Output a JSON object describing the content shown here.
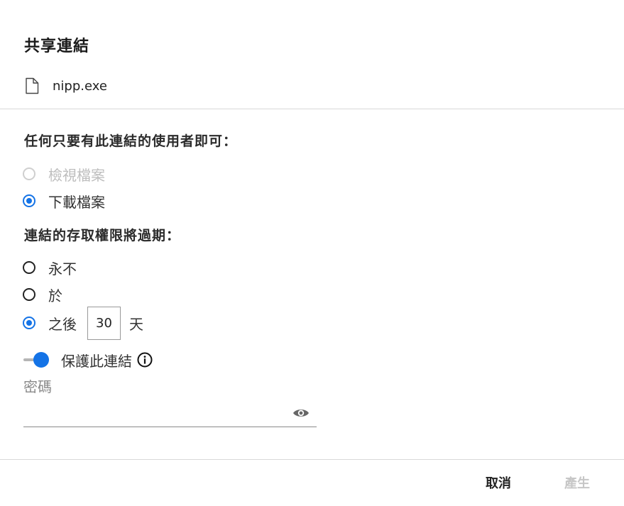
{
  "dialog": {
    "title": "共享連結",
    "file": {
      "name": "nipp.exe",
      "icon": "file-icon"
    }
  },
  "permissions": {
    "heading": "任何只要有此連結的使用者即可：",
    "options": [
      {
        "label": "檢視檔案",
        "checked": false,
        "disabled": true
      },
      {
        "label": "下載檔案",
        "checked": true,
        "disabled": false
      }
    ]
  },
  "expiration": {
    "heading": "連結的存取權限將過期：",
    "options": [
      {
        "label": "永不",
        "checked": false
      },
      {
        "label": "於",
        "checked": false
      },
      {
        "label": "之後",
        "checked": true
      }
    ],
    "days_value": "30",
    "days_unit": "天"
  },
  "protect": {
    "label": "保護此連結",
    "enabled": true,
    "info_icon": "info-icon"
  },
  "password": {
    "label": "密碼",
    "value": "",
    "reveal_icon": "eye-icon"
  },
  "footer": {
    "cancel_label": "取消",
    "create_label": "產生"
  },
  "colors": {
    "accent": "#1473e6",
    "disabled_text": "#c6c6c6",
    "divider": "#d9d9d9"
  }
}
